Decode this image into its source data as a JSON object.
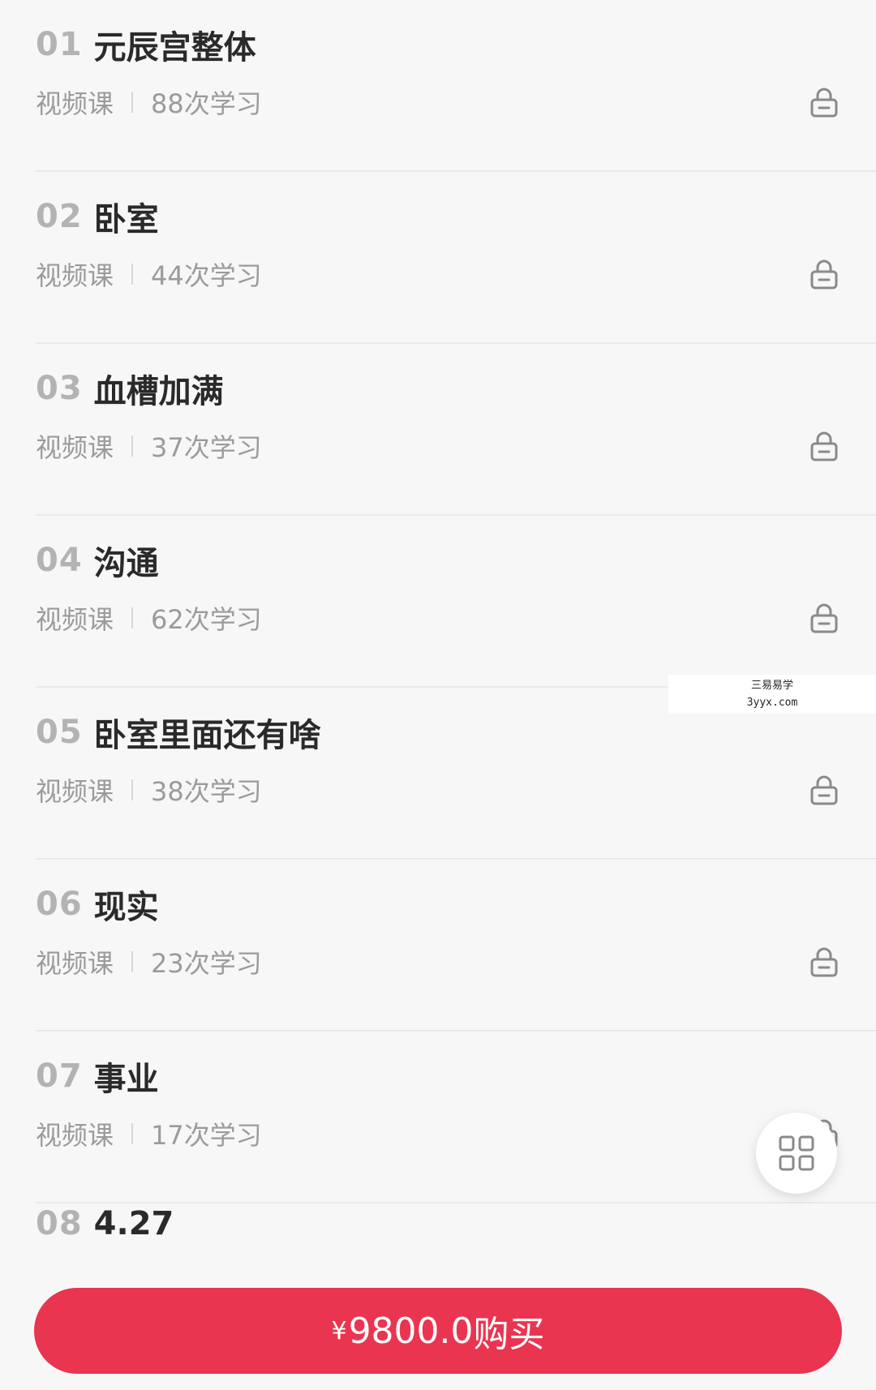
{
  "lessons": [
    {
      "num": "01",
      "title": "元辰宫整体",
      "type": "视频课",
      "count": "88次学习",
      "locked": true
    },
    {
      "num": "02",
      "title": "卧室",
      "type": "视频课",
      "count": "44次学习",
      "locked": true
    },
    {
      "num": "03",
      "title": "血槽加满",
      "type": "视频课",
      "count": "37次学习",
      "locked": true
    },
    {
      "num": "04",
      "title": "沟通",
      "type": "视频课",
      "count": "62次学习",
      "locked": true
    },
    {
      "num": "05",
      "title": "卧室里面还有啥",
      "type": "视频课",
      "count": "38次学习",
      "locked": true
    },
    {
      "num": "06",
      "title": "现实",
      "type": "视频课",
      "count": "23次学习",
      "locked": true
    },
    {
      "num": "07",
      "title": "事业",
      "type": "视频课",
      "count": "17次学习",
      "locked": true
    },
    {
      "num": "08",
      "title": "4.27"
    }
  ],
  "watermark": {
    "line1": "三易易学",
    "line2": "3yyx.com"
  },
  "buy": {
    "currency": "¥",
    "price": "9800.0",
    "action": "购买"
  },
  "colors": {
    "accent": "#ea3550",
    "muted": "#9b9b9b",
    "background": "#f7f7f8"
  }
}
